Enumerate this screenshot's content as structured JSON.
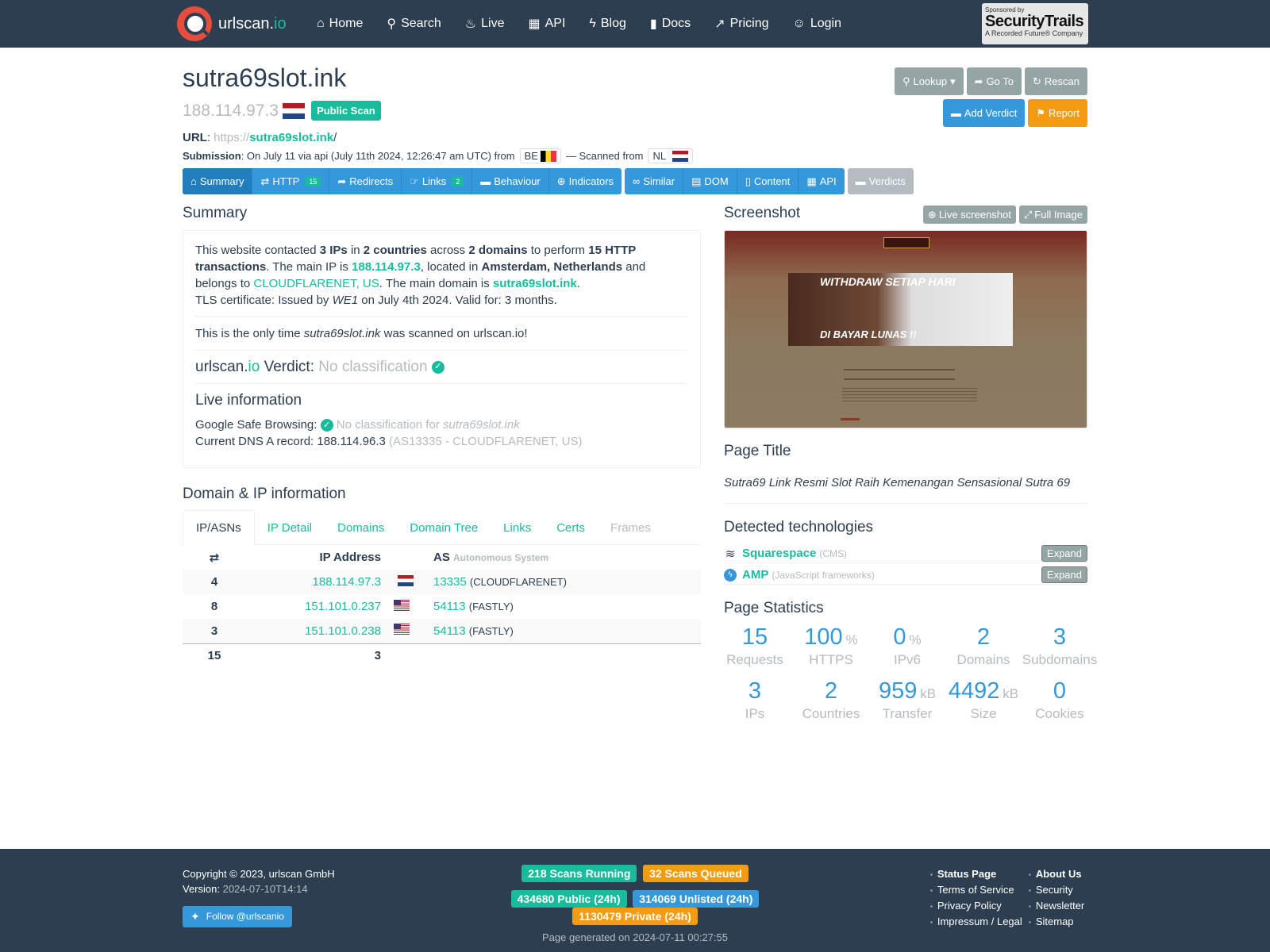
{
  "nav": {
    "brand_main": "urlscan.",
    "brand_io": "io",
    "items": [
      {
        "label": "Home",
        "icon": "home-icon"
      },
      {
        "label": "Search",
        "icon": "search-icon"
      },
      {
        "label": "Live",
        "icon": "fire-icon"
      },
      {
        "label": "API",
        "icon": "qrcode-icon"
      },
      {
        "label": "Blog",
        "icon": "bolt-icon"
      },
      {
        "label": "Docs",
        "icon": "bookmark-icon"
      },
      {
        "label": "Pricing",
        "icon": "external-link-icon"
      },
      {
        "label": "Login",
        "icon": "user-icon"
      }
    ],
    "sponsor_small": "Sponsored by",
    "sponsor_name": "SecurityTrails",
    "sponsor_sub": "A Recorded Future® Company"
  },
  "header": {
    "domain": "sutra69slot.ink",
    "ip": "188.114.97.3",
    "public_badge": "Public Scan",
    "url_label": "URL",
    "url_scheme": "https://",
    "url_host": "sutra69slot.ink",
    "url_path": "/",
    "submission_label": "Submission",
    "submission_text": ": On July 11 via api (July 11th 2024, 12:26:47 am UTC) from",
    "from_cc": "BE",
    "scanned_from_text": "— Scanned from",
    "scanned_cc": "NL"
  },
  "actions": {
    "lookup": "Lookup",
    "goto": "Go To",
    "rescan": "Rescan",
    "add_verdict": "Add Verdict",
    "report": "Report"
  },
  "tabs": {
    "summary": "Summary",
    "http": "HTTP",
    "http_count": "15",
    "redirects": "Redirects",
    "links": "Links",
    "links_count": "2",
    "behaviour": "Behaviour",
    "indicators": "Indicators",
    "similar": "Similar",
    "dom": "DOM",
    "content": "Content",
    "api": "API",
    "verdicts": "Verdicts"
  },
  "summary": {
    "heading": "Summary",
    "p1_a": "This website contacted ",
    "ips": "3 IPs",
    "p1_b": " in ",
    "countries": "2 countries",
    "p1_c": " across ",
    "domains": "2 domains",
    "p1_d": " to perform ",
    "transactions": "15 HTTP transactions",
    "p1_e": ". The main IP is ",
    "main_ip": "188.114.97.3",
    "p1_f": ", located in ",
    "location": "Amsterdam, Netherlands",
    "p1_g": " and belongs to ",
    "asn_name": "CLOUDFLARENET, US",
    "p1_h": ". The main domain is ",
    "main_domain": "sutra69slot.ink",
    "p1_i": ".",
    "tls_a": "TLS certificate: Issued by ",
    "tls_issuer": "WE1",
    "tls_b": " on July 4th 2024. Valid for: 3 months.",
    "only_a": "This is the only time ",
    "only_domain": "sutra69slot.ink",
    "only_b": " was scanned on urlscan.io!",
    "verdict_brand": "urlscan.",
    "verdict_io": "io",
    "verdict_label": " Verdict: ",
    "verdict_value": "No classification",
    "live_heading": "Live information",
    "gsb_label": "Google Safe Browsing: ",
    "gsb_value": "No classification for ",
    "gsb_domain": "sutra69slot.ink",
    "dns_label": "Current DNS A record: ",
    "dns_value": "188.114.96.3",
    "dns_as": " (AS13335 - CLOUDFLARENET, US)"
  },
  "domain_ip": {
    "heading": "Domain & IP information",
    "tabs": [
      "IP/ASNs",
      "IP Detail",
      "Domains",
      "Domain Tree",
      "Links",
      "Certs",
      "Frames"
    ],
    "col_ip": "IP Address",
    "col_as": "AS",
    "col_as_sub": "Autonomous System",
    "rows": [
      {
        "count": "4",
        "ip": "188.114.97.3",
        "flag": "NL",
        "asn": "13335",
        "asname": "(CLOUDFLARENET)"
      },
      {
        "count": "8",
        "ip": "151.101.0.237",
        "flag": "US",
        "asn": "54113",
        "asname": "(FASTLY)"
      },
      {
        "count": "3",
        "ip": "151.101.0.238",
        "flag": "US",
        "asn": "54113",
        "asname": "(FASTLY)"
      }
    ],
    "total_count": "15",
    "total_ips": "3"
  },
  "screenshot": {
    "heading": "Screenshot",
    "live_btn": "Live screenshot",
    "full_btn": "Full Image"
  },
  "page_title": {
    "heading": "Page Title",
    "value": "Sutra69 Link Resmi Slot Raih Kemenangan Sensasional Sutra 69"
  },
  "technologies": {
    "heading": "Detected technologies",
    "items": [
      {
        "name": "Squarespace",
        "category": "(CMS)",
        "expand": "Expand"
      },
      {
        "name": "AMP",
        "category": "(JavaScript frameworks)",
        "expand": "Expand"
      }
    ]
  },
  "stats": {
    "heading": "Page Statistics",
    "items": [
      {
        "value": "15",
        "unit": "",
        "label": "Requests"
      },
      {
        "value": "100",
        "unit": "%",
        "label": "HTTPS"
      },
      {
        "value": "0",
        "unit": "%",
        "label": "IPv6"
      },
      {
        "value": "2",
        "unit": "",
        "label": "Domains"
      },
      {
        "value": "3",
        "unit": "",
        "label": "Subdomains"
      },
      {
        "value": "3",
        "unit": "",
        "label": "IPs"
      },
      {
        "value": "2",
        "unit": "",
        "label": "Countries"
      },
      {
        "value": "959",
        "unit": "kB",
        "label": "Transfer"
      },
      {
        "value": "4492",
        "unit": "kB",
        "label": "Size"
      },
      {
        "value": "0",
        "unit": "",
        "label": "Cookies"
      }
    ]
  },
  "footer": {
    "copyright": "Copyright © 2023, urlscan GmbH",
    "version_label": "Version: ",
    "version": "2024-07-10T14:14",
    "follow": "Follow @urlscanio",
    "running": "218 Scans Running",
    "queued": "32 Scans Queued",
    "public": "434680 Public (24h)",
    "unlisted": "314069 Unlisted (24h)",
    "private": "1130479 Private (24h)",
    "generated": "Page generated on 2024-07-11 00:27:55",
    "links_col1": [
      "Status Page",
      "Terms of Service",
      "Privacy Policy",
      "Impressum / Legal"
    ],
    "links_col2": [
      "About Us",
      "Security",
      "Newsletter",
      "Sitemap"
    ]
  },
  "colors": {
    "navbar": "#2c3e50",
    "accent_green": "#18bc9c",
    "primary_blue": "#3498db",
    "warning_orange": "#f39c12",
    "muted_gray": "#b4bcc2"
  }
}
